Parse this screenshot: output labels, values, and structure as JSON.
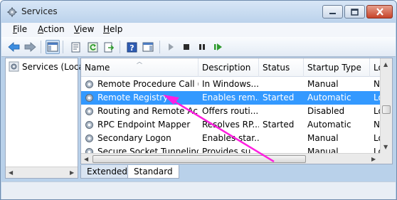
{
  "window": {
    "title": "Services"
  },
  "menu": {
    "items": [
      {
        "accel": "F",
        "rest": "ile"
      },
      {
        "accel": "A",
        "rest": "ction"
      },
      {
        "accel": "V",
        "rest": "iew"
      },
      {
        "accel": "H",
        "rest": "elp"
      }
    ]
  },
  "toolbar": {
    "buttons": [
      "back-arrow-icon",
      "forward-arrow-icon",
      "show-hide-console-tree-icon",
      "properties-icon",
      "refresh-icon",
      "export-list-icon",
      "help-icon",
      "show-hide-action-pane-icon",
      "start-service-icon",
      "stop-service-icon",
      "pause-service-icon",
      "restart-service-icon"
    ]
  },
  "tree": {
    "root_label": "Services (Loca"
  },
  "list": {
    "columns": [
      "Name",
      "Description",
      "Status",
      "Startup Type",
      "Lo"
    ],
    "rows": [
      {
        "name": "Remote Procedure Call (...",
        "description": "In Windows...",
        "status": "",
        "startup": "Manual",
        "logon": "N"
      },
      {
        "name": "Remote Registry",
        "description": "Enables rem...",
        "status": "Started",
        "startup": "Automatic",
        "logon": "Lo",
        "selected": true
      },
      {
        "name": "Routing and Remote Ac...",
        "description": "Offers routi...",
        "status": "",
        "startup": "Disabled",
        "logon": "Lo"
      },
      {
        "name": "RPC Endpoint Mapper",
        "description": "Resolves RP...",
        "status": "Started",
        "startup": "Automatic",
        "logon": "N"
      },
      {
        "name": "Secondary Logon",
        "description": "Enables star...",
        "status": "",
        "startup": "Manual",
        "logon": "Lo"
      },
      {
        "name": "Secure Socket Tunneling...",
        "description": "Provides su...",
        "status": "",
        "startup": "Manual",
        "logon": "Lo"
      }
    ]
  },
  "tabs": [
    "Extended",
    "Standard"
  ],
  "colors": {
    "selection": "#3399ff",
    "annotation_arrow": "#ff1ee0"
  }
}
